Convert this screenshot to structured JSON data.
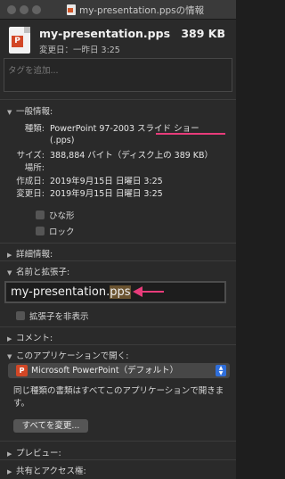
{
  "window": {
    "title": "my-presentation.ppsの情報"
  },
  "header": {
    "file_name": "my-presentation.pps",
    "file_size": "389 KB",
    "modified_label": "変更日：一昨日 3:25"
  },
  "tags": {
    "placeholder": "タグを追加..."
  },
  "general": {
    "header": "一般情報:",
    "kind_label": "種類:",
    "kind_value_line1": "PowerPoint 97-2003 スライド ショー",
    "kind_value_line2": "(.pps)",
    "size_label": "サイズ:",
    "size_value": "388,884 バイト（ディスク上の 389 KB）",
    "where_label": "場所:",
    "created_label": "作成日:",
    "created_value": "2019年9月15日 日曜日 3:25",
    "modified_label": "変更日:",
    "modified_value": "2019年9月15日 日曜日 3:25",
    "stationery_label": "ひな形",
    "locked_label": "ロック"
  },
  "more_info": {
    "header": "詳細情報:"
  },
  "name_extension": {
    "header": "名前と拡張子:",
    "name_base": "my-presentation.",
    "name_ext": "pps",
    "hide_extension_label": "拡張子を非表示"
  },
  "comments": {
    "header": "コメント:"
  },
  "open_with": {
    "header": "このアプリケーションで開く:",
    "app_value": "Microsoft PowerPoint（デフォルト）",
    "description": "同じ種類の書類はすべてこのアプリケーションで開きます。",
    "change_all_label": "すべてを変更..."
  },
  "preview": {
    "header": "プレビュー:"
  },
  "sharing": {
    "header": "共有とアクセス権:"
  },
  "colors": {
    "annotation_accent": "#e83c7a",
    "powerpoint_red": "#d24726",
    "select_blue": "#2f6fdc"
  }
}
